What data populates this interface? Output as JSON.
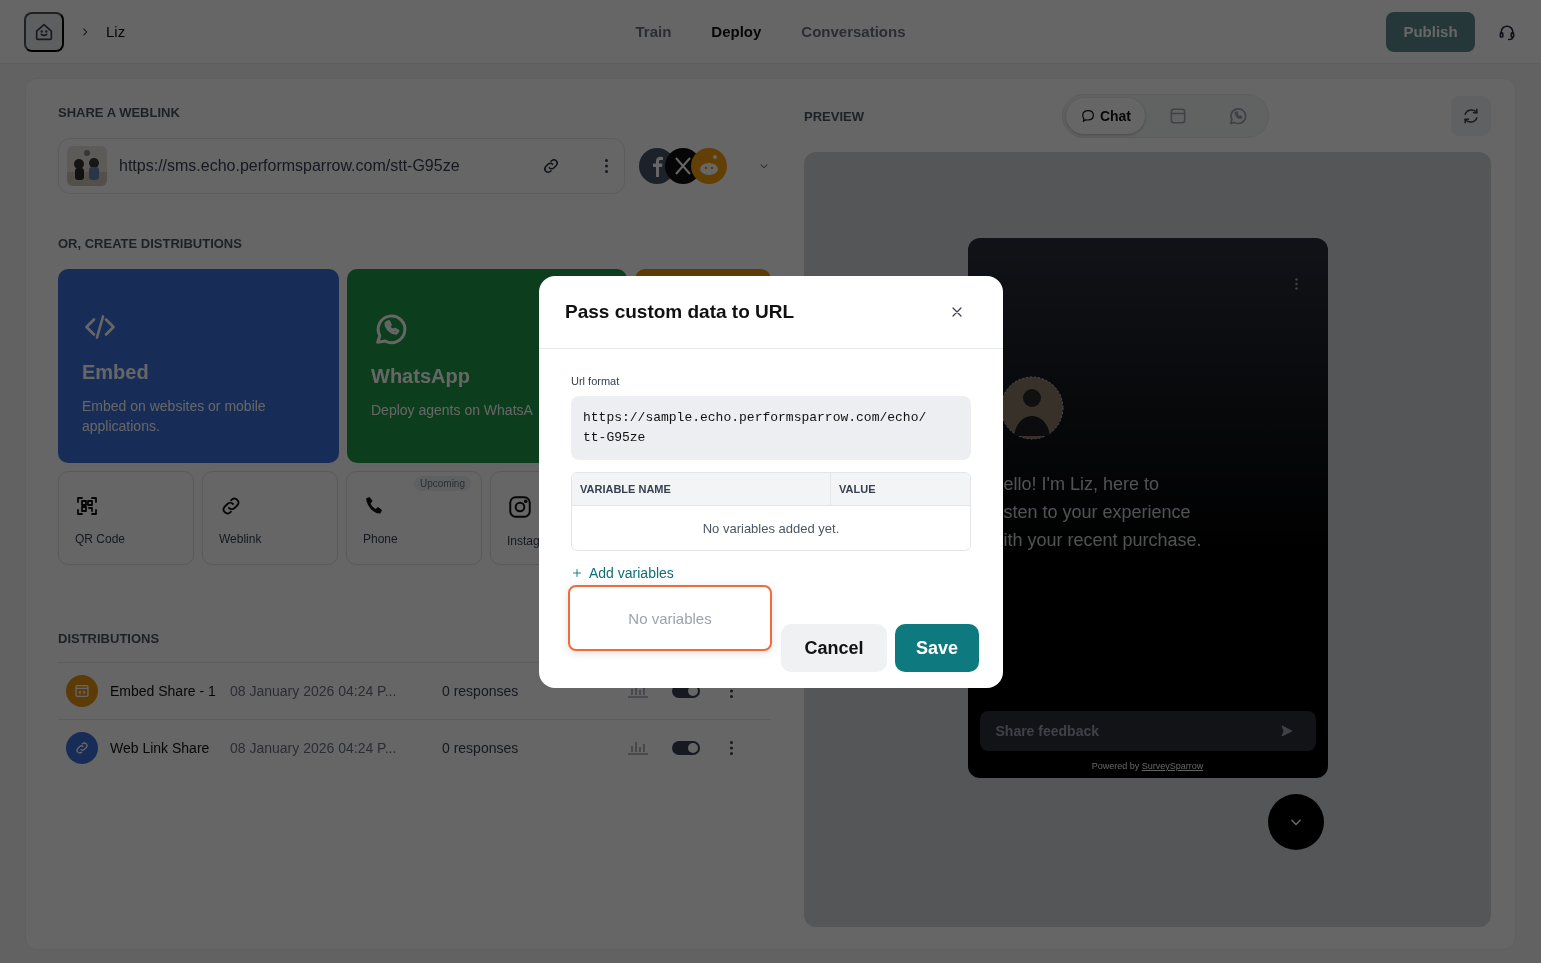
{
  "header": {
    "breadcrumb": "Liz",
    "nav": [
      {
        "label": "Train",
        "selected": false
      },
      {
        "label": "Deploy",
        "selected": true
      },
      {
        "label": "Conversations",
        "selected": false
      }
    ],
    "publish": "Publish"
  },
  "share": {
    "heading": "SHARE A WEBLINK",
    "url": "https://sms.echo.performsparrow.com/stt-G95ze"
  },
  "create": {
    "heading": "OR, CREATE DISTRIBUTIONS",
    "cards": [
      {
        "kind": "embed",
        "title": "Embed",
        "description": "Embed on websites or mobile applications."
      },
      {
        "kind": "whatsapp",
        "title": "WhatsApp",
        "description": "Deploy agents on WhatsA"
      },
      {
        "kind": "other"
      }
    ],
    "tiles": [
      {
        "kind": "qr",
        "label": "QR Code"
      },
      {
        "kind": "weblink",
        "label": "Weblink"
      },
      {
        "kind": "phone",
        "label": "Phone",
        "badge": "Upcoming"
      },
      {
        "kind": "instagram",
        "label": "Instag"
      }
    ]
  },
  "distributions": {
    "heading": "DISTRIBUTIONS",
    "rows": [
      {
        "kind": "embed",
        "name": "Embed Share - 1",
        "date": "08 January 2026 04:24 P...",
        "responses": "0 responses",
        "on": true
      },
      {
        "kind": "weblink",
        "name": "Web Link Share",
        "date": "08 January 2026 04:24 P...",
        "responses": "0 responses",
        "on": true
      }
    ]
  },
  "preview": {
    "heading": "PREVIEW",
    "modes": [
      {
        "kind": "chat",
        "label": "Chat",
        "selected": true
      },
      {
        "kind": "layout",
        "selected": false
      },
      {
        "kind": "whatsapp",
        "selected": false
      }
    ],
    "message": "ello! I'm Liz, here to\nsten to your experience\nith your recent purchase.",
    "placeholder": "Share feedback",
    "powered_by": "Powered by",
    "brand": "SurveySparrow"
  },
  "modal": {
    "title": "Pass custom data to URL",
    "url_label": "Url format",
    "url_format": "https://sample.echo.performsparrow.com/echo/tt-G95ze",
    "columns": [
      "VARIABLE NAME",
      "VALUE"
    ],
    "empty": "No variables added yet.",
    "add": "Add variables",
    "dropdown_empty": "No variables",
    "cancel": "Cancel",
    "save": "Save"
  }
}
